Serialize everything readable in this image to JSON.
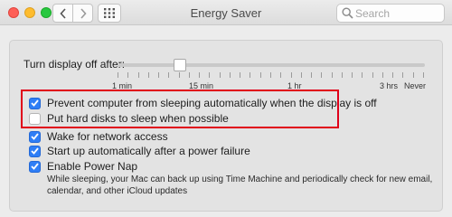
{
  "window": {
    "title": "Energy Saver",
    "search_placeholder": "Search"
  },
  "display_sleep": {
    "label": "Turn display off after:",
    "ticks": [
      "1 min",
      "15 min",
      "1 hr",
      "3 hrs",
      "Never"
    ],
    "selected": "15 min"
  },
  "options": [
    {
      "label": "Prevent computer from sleeping automatically when the display is off",
      "checked": true
    },
    {
      "label": "Put hard disks to sleep when possible",
      "checked": false
    },
    {
      "label": "Wake for network access",
      "checked": true
    },
    {
      "label": "Start up automatically after a power failure",
      "checked": true
    },
    {
      "label": "Enable Power Nap",
      "checked": true
    }
  ],
  "power_nap_description": "While sleeping, your Mac can back up using Time Machine and periodically check for new email, calendar, and other iCloud updates",
  "colors": {
    "accent": "#2f7ef6",
    "highlight": "#e0001a"
  }
}
